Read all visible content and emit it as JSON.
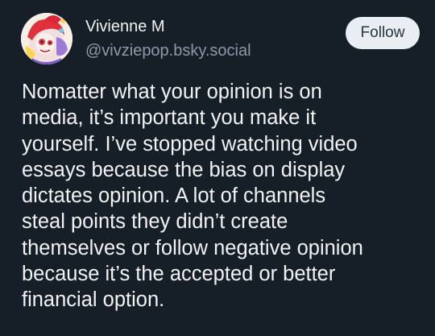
{
  "author": {
    "display_name": "Vivienne M",
    "handle": "@vivziepop.bsky.social",
    "avatar_icon": "avatar-image"
  },
  "actions": {
    "follow_label": "Follow"
  },
  "post": {
    "lines": [
      "Nomatter what your opinion is on",
      "media, it’s important you make it",
      "yourself. I’ve stopped watching video",
      "essays because the bias on display",
      "dictates opinion. A lot of channels",
      "steal points they didn’t create",
      "themselves or follow negative opinion",
      "because it’s the accepted or better",
      "financial option."
    ]
  },
  "colors": {
    "background": "#161e27",
    "text": "#f1f3f5",
    "handle": "#8f99a6",
    "button_bg": "#e9eef3",
    "button_text": "#2a3440"
  }
}
